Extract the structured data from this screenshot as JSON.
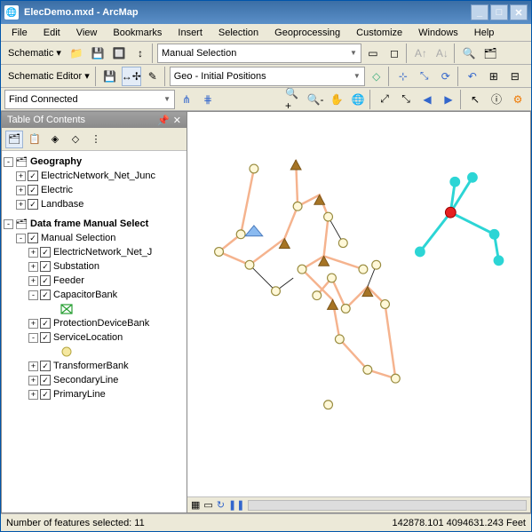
{
  "title": "ElecDemo.mxd - ArcMap",
  "win_buttons": {
    "min": "_",
    "max": "□",
    "close": "✕"
  },
  "menu": [
    "File",
    "Edit",
    "View",
    "Bookmarks",
    "Insert",
    "Selection",
    "Geoprocessing",
    "Customize",
    "Windows",
    "Help"
  ],
  "toolbar1": {
    "schematic_label": "Schematic ▾",
    "selection_mode": "Manual Selection"
  },
  "toolbar2": {
    "editor_label": "Schematic Editor ▾",
    "layout": "Geo - Initial Positions"
  },
  "toolbar3": {
    "find": "Find Connected"
  },
  "toc": {
    "title": "Table Of Contents",
    "groups": [
      {
        "label": "Geography",
        "icon": "🗂",
        "bold": true,
        "exp": "-",
        "indent": 0,
        "layers": [
          {
            "label": "ElectricNetwork_Net_Junc",
            "chk": true
          },
          {
            "label": "Electric",
            "chk": true
          },
          {
            "label": "Landbase",
            "chk": true
          }
        ]
      },
      {
        "label": "Data frame Manual Select",
        "icon": "🗂",
        "bold": true,
        "exp": "-",
        "indent": 0,
        "layers": [
          {
            "label": "Manual Selection",
            "chk": true,
            "exp": "-",
            "children": [
              {
                "label": "ElectricNetwork_Net_J",
                "chk": true,
                "exp": "+"
              },
              {
                "label": "Substation",
                "chk": true,
                "exp": "+"
              },
              {
                "label": "Feeder",
                "chk": true,
                "exp": "+"
              },
              {
                "label": "CapacitorBank",
                "chk": true,
                "exp": "-",
                "sym": "cap"
              },
              {
                "label": "ProtectionDeviceBank",
                "chk": true,
                "exp": "+"
              },
              {
                "label": "ServiceLocation",
                "chk": true,
                "exp": "-",
                "sym": "sl"
              },
              {
                "label": "TransformerBank",
                "chk": true,
                "exp": "+"
              },
              {
                "label": "SecondaryLine",
                "chk": true,
                "exp": "+"
              },
              {
                "label": "PrimaryLine",
                "chk": true,
                "exp": "+"
              }
            ]
          }
        ]
      }
    ]
  },
  "status": {
    "left": "Number of features selected: 11",
    "right": "142878.101 4094631.243 Feet"
  }
}
